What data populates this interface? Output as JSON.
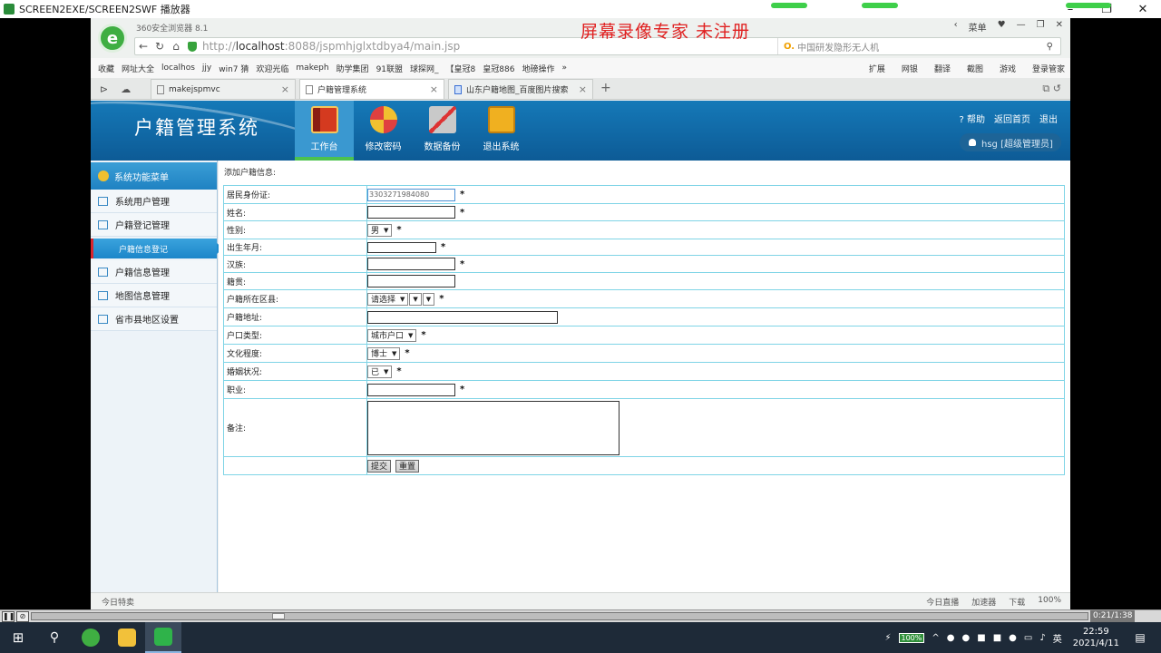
{
  "player": {
    "title": "SCREEN2EXE/SCREEN2SWF 播放器",
    "watermark": "屏幕录像专家  未注册",
    "time": "0:21/1:38",
    "progress": 0.23
  },
  "browser": {
    "name": "360安全浏览器 8.1",
    "url_host": "localhost",
    "url_prefix": "http://",
    "url_rest": ":8088/jspmhjglxtdbya4/main.jsp",
    "search_placeholder": "中国研发隐形无人机",
    "menu_label": "菜单",
    "bookmarks": [
      "收藏",
      "网址大全",
      "localhos",
      "jjy",
      "win7 猜",
      "欢迎光临",
      "makeph",
      "助学集团",
      "91联盟",
      "球探网_",
      "【皇冠8",
      "皇冠886",
      "地磅操作"
    ],
    "tools": [
      "扩展",
      "网银",
      "翻译",
      "截图",
      "游戏",
      "登录管家"
    ],
    "tabs": [
      {
        "label": "makejspmvc",
        "active": false
      },
      {
        "label": "户籍管理系统",
        "active": true
      },
      {
        "label": "山东户籍地图_百度图片搜索",
        "active": false
      }
    ],
    "status_left": "今日特卖",
    "status_right": [
      "今日直播",
      "加速器",
      "下载",
      "100%"
    ]
  },
  "app": {
    "title": "户籍管理系统",
    "menu": [
      {
        "label": "工作台",
        "icon": "book-icon",
        "active": true
      },
      {
        "label": "修改密码",
        "icon": "tools-icon",
        "active": false
      },
      {
        "label": "数据备份",
        "icon": "wrench-icon",
        "active": false
      },
      {
        "label": "退出系统",
        "icon": "download-box-icon",
        "active": false
      }
    ],
    "header_links": [
      "? 帮助",
      "返回首页",
      "退出"
    ],
    "user": "hsg [超级管理员]"
  },
  "sidebar": {
    "head": "系统功能菜单",
    "items": [
      "系统用户管理",
      "户籍登记管理",
      "户籍信息管理",
      "地图信息管理",
      "省市县地区设置"
    ],
    "sub_active": "户籍信息登记"
  },
  "form": {
    "title": "添加户籍信息:",
    "fields": [
      {
        "label": "居民身份证:",
        "value": "3303271984080"
      },
      {
        "label": "姓名:"
      },
      {
        "label": "性别:",
        "select": "男"
      },
      {
        "label": "出生年月:"
      },
      {
        "label": "汉族:"
      },
      {
        "label": "籍贯:"
      },
      {
        "label": "户籍所在区县:",
        "select": "请选择"
      },
      {
        "label": "户籍地址:"
      },
      {
        "label": "户口类型:",
        "select": "城市户口"
      },
      {
        "label": "文化程度:",
        "select": "博士"
      },
      {
        "label": "婚姻状况:",
        "select": "已"
      },
      {
        "label": "职业:"
      },
      {
        "label": "备注:"
      }
    ],
    "submit": "提交",
    "reset": "重置",
    "required_mark": "*"
  },
  "taskbar": {
    "battery": "100%",
    "ime": "英",
    "time": "22:59",
    "date": "2021/4/11"
  }
}
